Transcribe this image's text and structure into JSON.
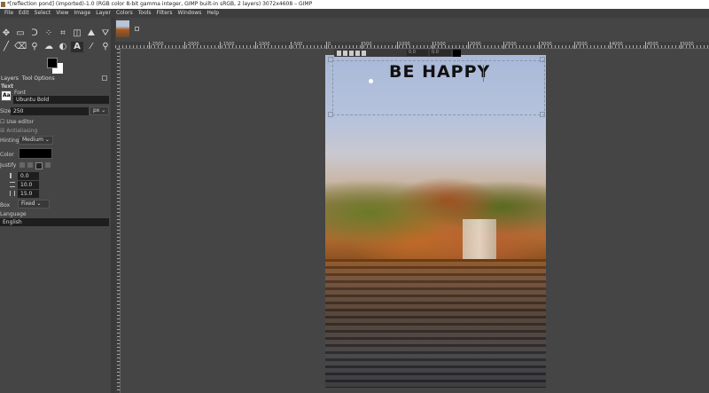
{
  "window": {
    "title": "*[reflection pond] (imported)-1.0 (RGB color 8-bit gamma integer, GIMP built-in sRGB, 2 layers) 3072x4608 – GIMP"
  },
  "menu": [
    "File",
    "Edit",
    "Select",
    "View",
    "Image",
    "Layer",
    "Colors",
    "Tools",
    "Filters",
    "Windows",
    "Help"
  ],
  "toolbox": {
    "icons": [
      "move-icon",
      "rect-select-icon",
      "lasso-icon",
      "fuzzy-select-icon",
      "crop-icon",
      "unified-transform-icon",
      "warp-icon",
      "bucket-fill-icon",
      "paintbrush-icon",
      "eraser-icon",
      "clone-icon",
      "smudge-icon",
      "dodge-icon",
      "text-icon",
      "color-picker-icon",
      "zoom-icon"
    ],
    "glyphs": [
      "✥",
      "▭",
      "ᑐ",
      "⁘",
      "⌗",
      "◫",
      "⛰",
      "⛛",
      "╱",
      "⌫",
      "⚲",
      "☁",
      "◐",
      "A",
      "⁄",
      "⚲"
    ],
    "selected": "text-icon",
    "fg_color": "#000000",
    "bg_color": "#ffffff"
  },
  "dock": {
    "tabs": [
      "Layers",
      "Tool Options"
    ]
  },
  "tool_options": {
    "heading": "Text",
    "font_label": "Font",
    "font": "Ubuntu Bold",
    "font_icon": "Aa",
    "size_label": "Size",
    "size": "250",
    "unit": "px",
    "use_editor": "Use editor",
    "antialiasing": "Antialiasing",
    "hinting_label": "Hinting",
    "hinting": "Medium",
    "color_label": "Color",
    "color": "#000000",
    "justify_label": "Justify",
    "indent": "0.0",
    "line_spacing": "10.0",
    "letter_spacing": "15.0",
    "box_label": "Box",
    "box": "Fixed",
    "language_label": "Language",
    "language": "English"
  },
  "ruler": {
    "labels": [
      "-2500",
      "-2000",
      "-1500",
      "-1000",
      "-500",
      "0",
      "500",
      "1000",
      "1500",
      "2000",
      "2500",
      "3000",
      "3500",
      "4000",
      "4500",
      "5000"
    ]
  },
  "canvas": {
    "text": "BE HAPPY",
    "style_editor": {
      "baseline": "0.0",
      "kerning": "0.0"
    }
  }
}
